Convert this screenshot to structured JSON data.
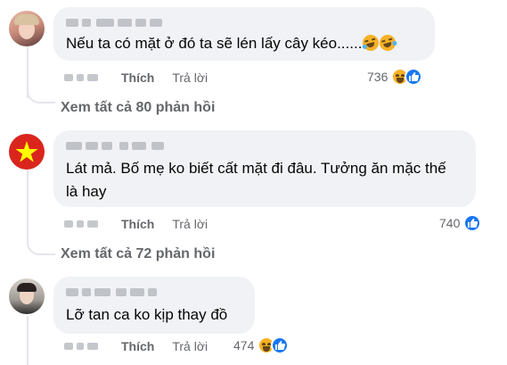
{
  "comments": [
    {
      "text": "Nếu ta có mặt ở đó ta sẽ lén lấy cây kéo......",
      "like_label": "Thích",
      "reply_label": "Trả lời",
      "reaction_count": "736",
      "reaction_icons": [
        "haha-icon",
        "like-icon"
      ],
      "view_replies": "Xem tất cả 80 phản hồi"
    },
    {
      "text": "Lát mả. Bố mẹ ko biết cất mặt đi đâu. Tưởng ăn mặc thế là hay",
      "like_label": "Thích",
      "reply_label": "Trả lời",
      "reaction_count": "740",
      "reaction_icons": [
        "like-icon"
      ],
      "view_replies": "Xem tất cả 72 phản hồi"
    },
    {
      "text": "Lỡ tan ca ko kịp thay đồ",
      "like_label": "Thích",
      "reply_label": "Trả lời",
      "reaction_count": "474",
      "reaction_icons": [
        "haha-icon",
        "like-icon"
      ]
    }
  ],
  "colors": {
    "bubble": "#f0f2f5",
    "meta_text": "#65676b",
    "like_blue": "#1877f2",
    "haha_yellow": "#f7b125",
    "flag_red": "#da251d",
    "flag_star": "#ffff00"
  }
}
